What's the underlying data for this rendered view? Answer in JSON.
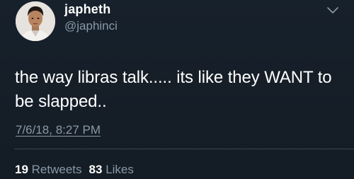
{
  "user": {
    "display_name": "japheth",
    "handle": "@japhinci",
    "avatar_icon": "profile-photo"
  },
  "tweet": {
    "text_line1": "the way libras talk..... its like they WANT to",
    "text_line2": "be slapped..",
    "timestamp": "7/6/18, 8:27 PM"
  },
  "stats": {
    "retweets_count": "19",
    "retweets_label": "Retweets",
    "likes_count": "83",
    "likes_label": "Likes"
  },
  "icons": {
    "menu": "chevron-down-icon"
  },
  "colors": {
    "background": "#141d26",
    "text": "#ffffff",
    "secondary": "#8899a6",
    "divider": "#38444d"
  }
}
